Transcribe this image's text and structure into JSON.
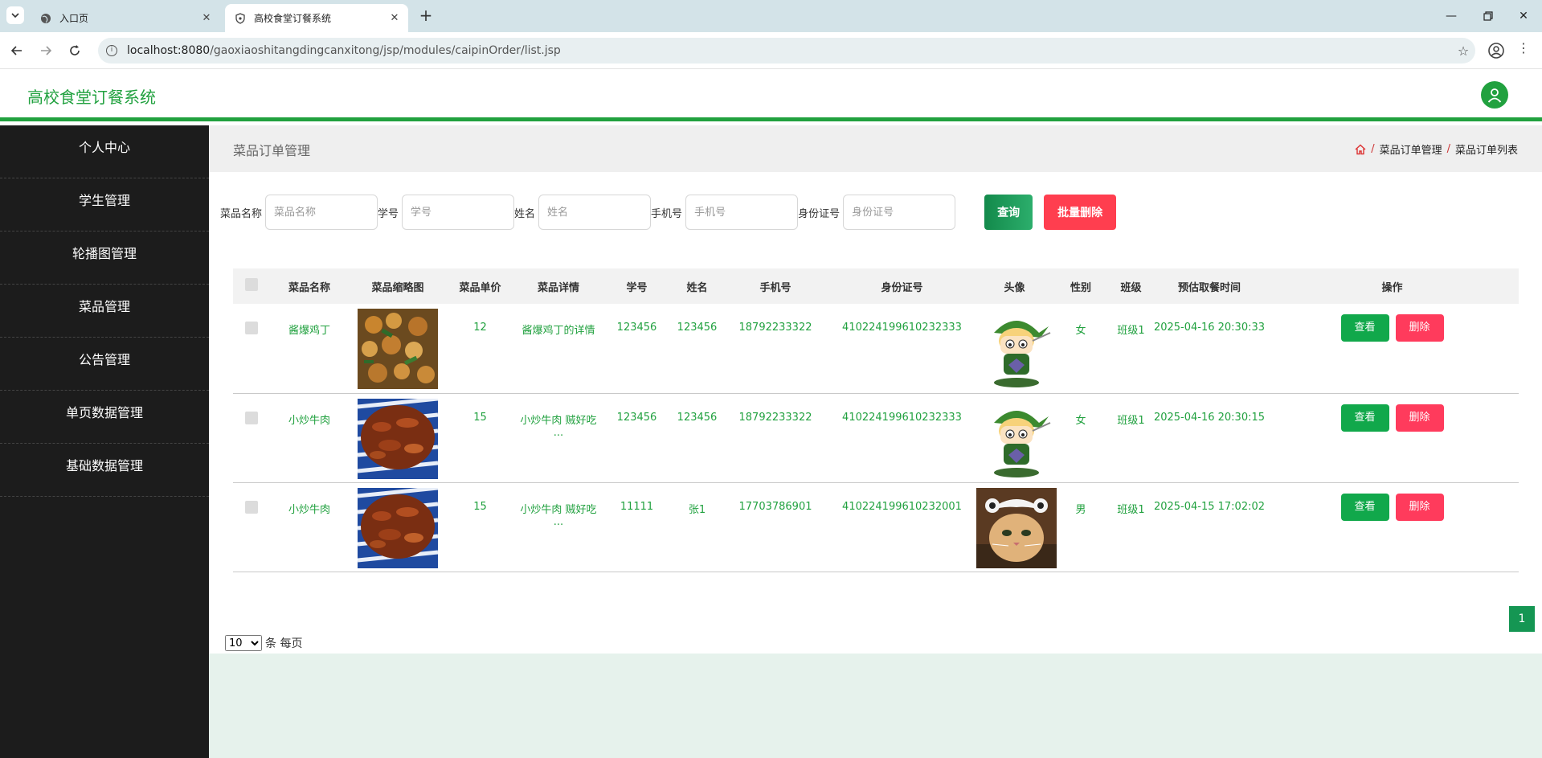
{
  "browser": {
    "tabs": [
      {
        "label": "入口页",
        "icon": "globe-icon",
        "active": false
      },
      {
        "label": "高校食堂订餐系统",
        "icon": "shield-icon",
        "active": true
      }
    ],
    "url_host": "localhost:8080",
    "url_path": "/gaoxiaoshitangdingcanxitong/jsp/modules/caipinOrder/list.jsp"
  },
  "header": {
    "title": "高校食堂订餐系统"
  },
  "sidebar": {
    "items": [
      {
        "label": "个人中心"
      },
      {
        "label": "学生管理"
      },
      {
        "label": "轮播图管理"
      },
      {
        "label": "菜品管理"
      },
      {
        "label": "公告管理"
      },
      {
        "label": "单页数据管理"
      },
      {
        "label": "基础数据管理"
      }
    ]
  },
  "breadcrumb": {
    "title": "菜品订单管理",
    "trail": [
      "菜品订单管理",
      "菜品订单列表"
    ]
  },
  "search": {
    "fields": [
      {
        "label": "菜品名称",
        "placeholder": "菜品名称"
      },
      {
        "label": "学号",
        "placeholder": "学号"
      },
      {
        "label": "姓名",
        "placeholder": "姓名"
      },
      {
        "label": "手机号",
        "placeholder": "手机号"
      },
      {
        "label": "身份证号",
        "placeholder": "身份证号"
      }
    ],
    "query_label": "查询",
    "batch_delete_label": "批量删除"
  },
  "table": {
    "headers": [
      "菜品名称",
      "菜品缩略图",
      "菜品单价",
      "菜品详情",
      "学号",
      "姓名",
      "手机号",
      "身份证号",
      "头像",
      "性别",
      "班级",
      "预估取餐时间",
      "操作"
    ],
    "rows": [
      {
        "name": "酱爆鸡丁",
        "thumb": "chicken",
        "price": "12",
        "detail": "酱爆鸡丁的详情",
        "student_no": "123456",
        "student_name": "123456",
        "phone": "18792233322",
        "id_card": "410224199610232333",
        "avatar": "cartoon",
        "gender": "女",
        "class": "班级1",
        "time": "2025-04-16 20:30:33"
      },
      {
        "name": "小炒牛肉",
        "thumb": "beef",
        "price": "15",
        "detail": "小炒牛肉 贼好吃 ...",
        "student_no": "123456",
        "student_name": "123456",
        "phone": "18792233322",
        "id_card": "410224199610232333",
        "avatar": "cartoon",
        "gender": "女",
        "class": "班级1",
        "time": "2025-04-16 20:30:15"
      },
      {
        "name": "小炒牛肉",
        "thumb": "beef",
        "price": "15",
        "detail": "小炒牛肉 贼好吃 ...",
        "student_no": "11111",
        "student_name": "张1",
        "phone": "17703786901",
        "id_card": "410224199610232001",
        "avatar": "cat",
        "gender": "男",
        "class": "班级1",
        "time": "2025-04-15 17:02:02"
      }
    ],
    "view_label": "查看",
    "delete_label": "删除"
  },
  "pagination": {
    "page_size": "10",
    "page_size_suffix": "条 每页",
    "current_page": "1"
  },
  "colors": {
    "brand_green": "#21a13f",
    "danger_red": "#ff3b5c",
    "sidebar_bg": "#1c1c1c"
  }
}
